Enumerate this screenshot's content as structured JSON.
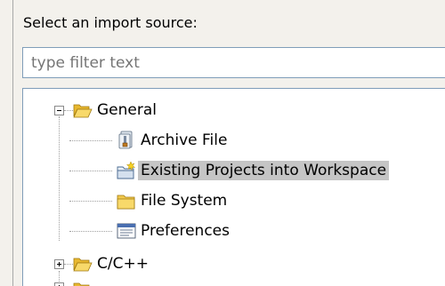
{
  "prompt_label": "Select an import source:",
  "filter": {
    "placeholder": "type filter text",
    "value": ""
  },
  "tree": {
    "general": {
      "label": "General",
      "expanded": true,
      "icon": "open-folder-icon",
      "children": [
        {
          "label": "Archive File",
          "icon": "archive-file-icon"
        },
        {
          "label": "Existing Projects into Workspace",
          "icon": "existing-projects-icon",
          "selected": true
        },
        {
          "label": "File System",
          "icon": "folder-icon"
        },
        {
          "label": "Preferences",
          "icon": "preferences-icon"
        }
      ]
    },
    "cpp": {
      "label": "C/C++",
      "expanded": false,
      "icon": "closed-folder-icon"
    }
  },
  "colors": {
    "selection": "#c5c5c5",
    "folder": "#f2c94c",
    "border": "#7f9db9"
  }
}
